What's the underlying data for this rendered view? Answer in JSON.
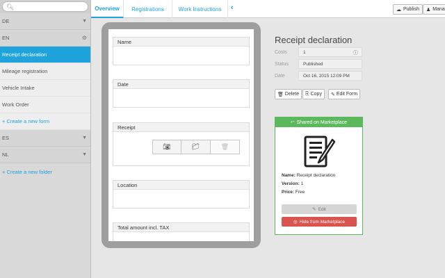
{
  "sidebar": {
    "search": {
      "placeholder": "",
      "value": ""
    },
    "groups": [
      {
        "label": "DE"
      },
      {
        "label": "EN"
      },
      {
        "label": "ES"
      },
      {
        "label": "NL"
      }
    ],
    "en_forms": [
      {
        "label": "Receipt declaration",
        "active": true
      },
      {
        "label": "Mileage registration"
      },
      {
        "label": "Vehicle Intake"
      },
      {
        "label": "Work Order"
      }
    ],
    "create_form_label": "+ Create a new form",
    "create_folder_label": "+ Create a new folder"
  },
  "topbar": {
    "tabs": [
      {
        "label": "Overview",
        "active": true
      },
      {
        "label": "Registrations"
      },
      {
        "label": "Work Instructions"
      }
    ],
    "publish_label": "Publish",
    "manage_label": "Mana"
  },
  "preview": {
    "fields": [
      {
        "label": "Name"
      },
      {
        "label": "Date"
      },
      {
        "label": "Receipt"
      },
      {
        "label": "Location"
      },
      {
        "label": "Total amount incl. TAX"
      }
    ]
  },
  "detail": {
    "title": "Receipt declaration",
    "props": [
      {
        "label": "Costs",
        "value": "1"
      },
      {
        "label": "Status",
        "value": "Published"
      },
      {
        "label": "Date",
        "value": "Oct 16, 2015 12:09 PM"
      }
    ],
    "buttons": {
      "delete": "Delete",
      "copy": "Copy",
      "edit_form": "Edit Form"
    }
  },
  "marketplace": {
    "header": "Shared on Marketplace",
    "name_label": "Name:",
    "name_value": "Receipt declaration",
    "version_label": "Version:",
    "version_value": "1",
    "price_label": "Price:",
    "price_value": "Free",
    "edit_label": "Edit",
    "hide_label": "Hide from Marketplace"
  },
  "colors": {
    "accent": "#1ea3dc",
    "success": "#5cb85c",
    "danger": "#d9534f"
  }
}
